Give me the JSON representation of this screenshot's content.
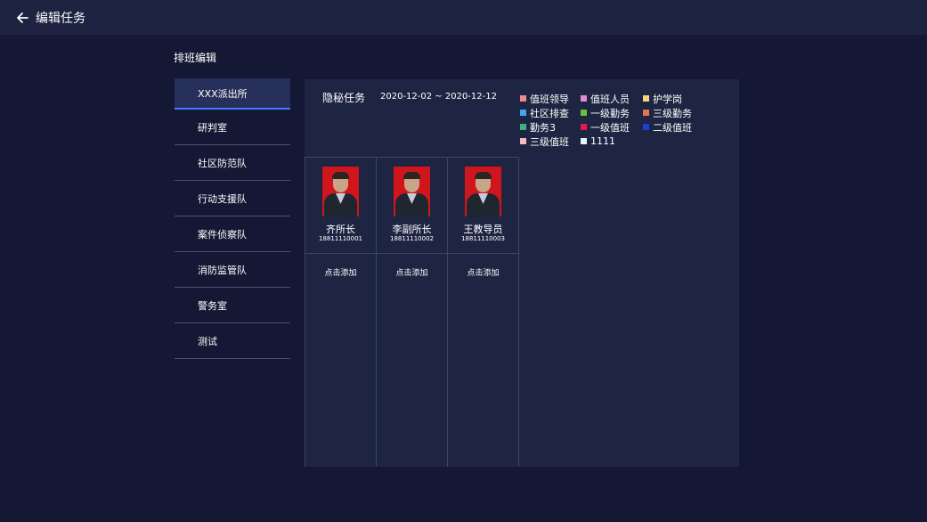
{
  "header": {
    "title": "编辑任务",
    "back_icon": "arrow-left-icon"
  },
  "section": {
    "title": "排班编辑"
  },
  "sidebar": {
    "items": [
      {
        "label": "XXX派出所",
        "active": true
      },
      {
        "label": "研判室"
      },
      {
        "label": "社区防范队"
      },
      {
        "label": "行动支援队"
      },
      {
        "label": "案件侦察队"
      },
      {
        "label": "消防监管队"
      },
      {
        "label": "警务室"
      },
      {
        "label": "测试"
      }
    ]
  },
  "task": {
    "name": "隐秘任务",
    "date_range": "2020-12-02 ~ 2020-12-12"
  },
  "legend": [
    {
      "label": "值班领导",
      "color": "#f08a8a"
    },
    {
      "label": "值班人员",
      "color": "#e48ad8"
    },
    {
      "label": "护学岗",
      "color": "#f5d67a"
    },
    {
      "label": "社区排查",
      "color": "#4aa3f0"
    },
    {
      "label": "一级勤务",
      "color": "#6cbf3a"
    },
    {
      "label": "三级勤务",
      "color": "#e8744a"
    },
    {
      "label": "勤务3",
      "color": "#3fae84"
    },
    {
      "label": "一级值班",
      "color": "#e8174a"
    },
    {
      "label": "二级值班",
      "color": "#1b3fd6"
    },
    {
      "label": "三级值班",
      "color": "#f5b8c4"
    },
    {
      "label": "1111",
      "color": "#e6f3f7"
    }
  ],
  "people": [
    {
      "name": "齐所长",
      "phone": "18811110001",
      "add_label": "点击添加"
    },
    {
      "name": "李副所长",
      "phone": "18811110002",
      "add_label": "点击添加"
    },
    {
      "name": "王教导员",
      "phone": "18811110003",
      "add_label": "点击添加"
    }
  ]
}
